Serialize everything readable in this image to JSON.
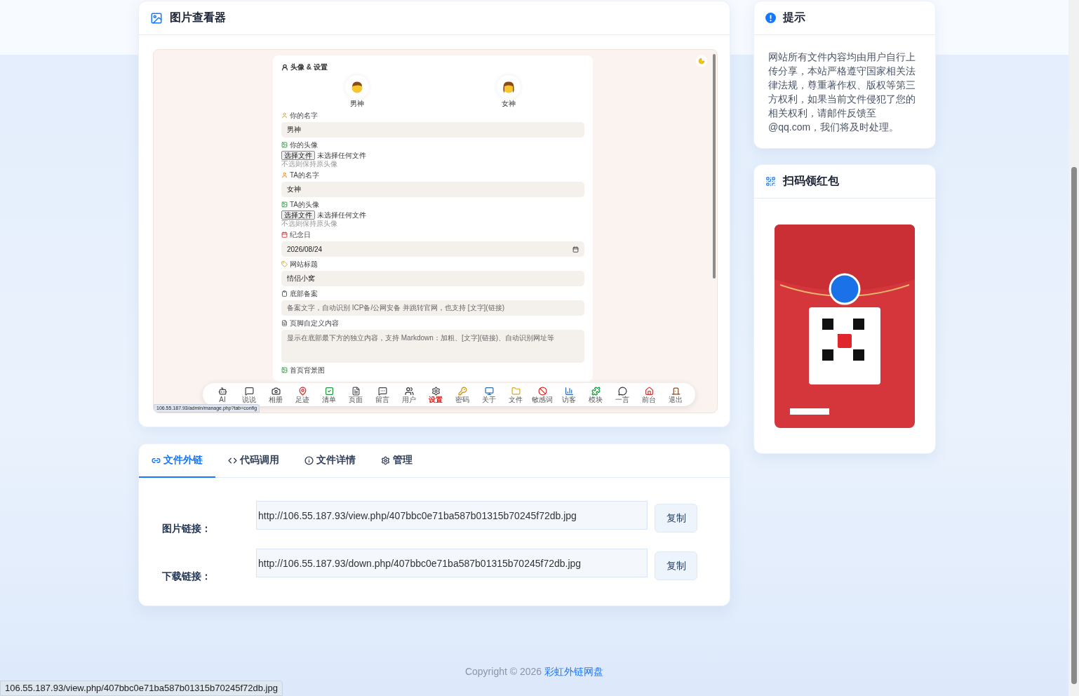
{
  "viewer": {
    "title": "图片查看器",
    "screenshot": {
      "section_title": "头像 & 设置",
      "avatars": [
        {
          "label": "男神"
        },
        {
          "label": "女神"
        }
      ],
      "fields": [
        {
          "kind": "text",
          "label": "你的名字",
          "value": "男神"
        },
        {
          "kind": "file",
          "label": "你的头像",
          "button": "选择文件",
          "status": "未选择任何文件",
          "hint": "不选则保持原头像"
        },
        {
          "kind": "text",
          "label": "TA的名字",
          "value": "女神"
        },
        {
          "kind": "file",
          "label": "TA的头像",
          "button": "选择文件",
          "status": "未选择任何文件",
          "hint": "不选则保持原头像"
        },
        {
          "kind": "date",
          "label": "纪念日",
          "value": "2026/08/24"
        },
        {
          "kind": "text",
          "label": "网站标题",
          "value": "情侣小窝"
        },
        {
          "kind": "text",
          "label": "底部备案",
          "placeholder": "备案文字，自动识别 ICP备/公网安备 并跳转官网，也支持 [文字](链接)"
        },
        {
          "kind": "textarea",
          "label": "页脚自定义内容",
          "placeholder": "显示在底部最下方的独立内容，支持 Markdown：加粗、[文字](链接)、自动识别网址等"
        },
        {
          "kind": "heading",
          "label": "首页背景图"
        }
      ],
      "nav": [
        {
          "label": "AI",
          "selected": false
        },
        {
          "label": "说说",
          "selected": false
        },
        {
          "label": "相册",
          "selected": false
        },
        {
          "label": "足迹",
          "selected": false
        },
        {
          "label": "清单",
          "selected": false
        },
        {
          "label": "页面",
          "selected": false
        },
        {
          "label": "留言",
          "selected": false
        },
        {
          "label": "用户",
          "selected": false
        },
        {
          "label": "设置",
          "selected": true
        },
        {
          "label": "密码",
          "selected": false
        },
        {
          "label": "关于",
          "selected": false
        },
        {
          "label": "文件",
          "selected": false
        },
        {
          "label": "敏感词",
          "selected": false
        },
        {
          "label": "访客",
          "selected": false
        },
        {
          "label": "模块",
          "selected": false
        },
        {
          "label": "一言",
          "selected": false
        },
        {
          "label": "前台",
          "selected": false
        },
        {
          "label": "退出",
          "selected": false
        }
      ],
      "status_url": "106.55.187.93/admin/manage.php?tab=config"
    }
  },
  "links": {
    "tabs": [
      {
        "label": "文件外链",
        "selected": true
      },
      {
        "label": "代码调用",
        "selected": false
      },
      {
        "label": "文件详情",
        "selected": false
      },
      {
        "label": "管理",
        "selected": false
      }
    ],
    "rows": [
      {
        "label": "图片链接：",
        "value": "http://106.55.187.93/view.php/407bbc0e71ba587b01315b70245f72db.jpg",
        "button": "复制"
      },
      {
        "label": "下载链接：",
        "value": "http://106.55.187.93/down.php/407bbc0e71ba587b01315b70245f72db.jpg",
        "button": "复制"
      }
    ]
  },
  "tips": {
    "title": "提示",
    "text": "网站所有文件内容均由用户自行上传分享，本站严格遵守国家相关法律法规，尊重著作权、版权等第三方权利，如果当前文件侵犯了您的相关权利，请邮件反馈至 @qq.com，我们将及时处理。"
  },
  "redpacket": {
    "title": "扫码领红包"
  },
  "footer": {
    "copyright": "Copyright © 2026",
    "site": "彩虹外链网盘"
  },
  "status_bar": "106.55.187.93/view.php/407bbc0e71ba587b01315b70245f72db.jpg"
}
